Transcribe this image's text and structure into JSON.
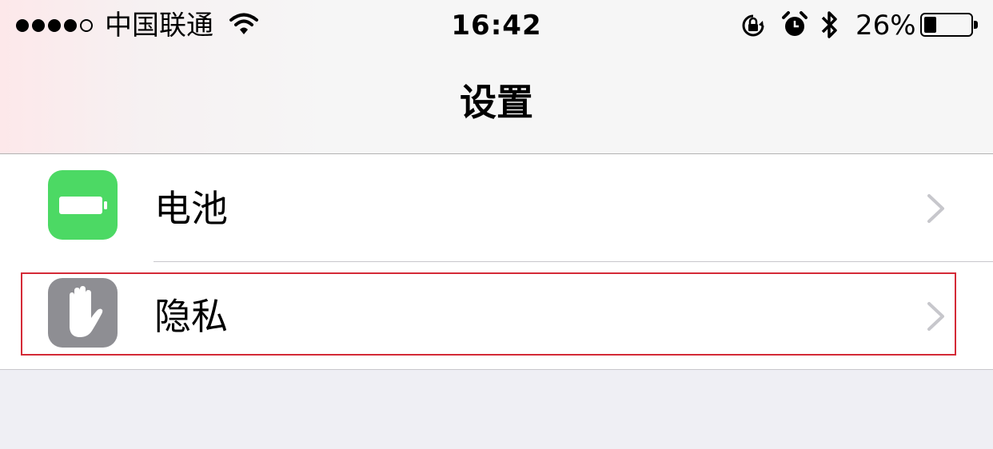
{
  "status_bar": {
    "signal_bars_filled": 4,
    "signal_bars_total": 5,
    "carrier": "中国联通",
    "time": "16:42",
    "battery_percent_text": "26%",
    "battery_level": 0.26,
    "icons": [
      "wifi-icon",
      "rotation-lock-icon",
      "alarm-icon",
      "bluetooth-icon",
      "battery-icon"
    ]
  },
  "nav": {
    "title": "设置"
  },
  "settings": {
    "items": [
      {
        "label": "电池",
        "icon": "battery-app-icon",
        "icon_color": "#4cd964"
      },
      {
        "label": "隐私",
        "icon": "hand-privacy-icon",
        "icon_color": "#8e8e93"
      }
    ]
  },
  "colors": {
    "highlight_border": "#d42a37",
    "chevron": "#c7c7cc"
  }
}
